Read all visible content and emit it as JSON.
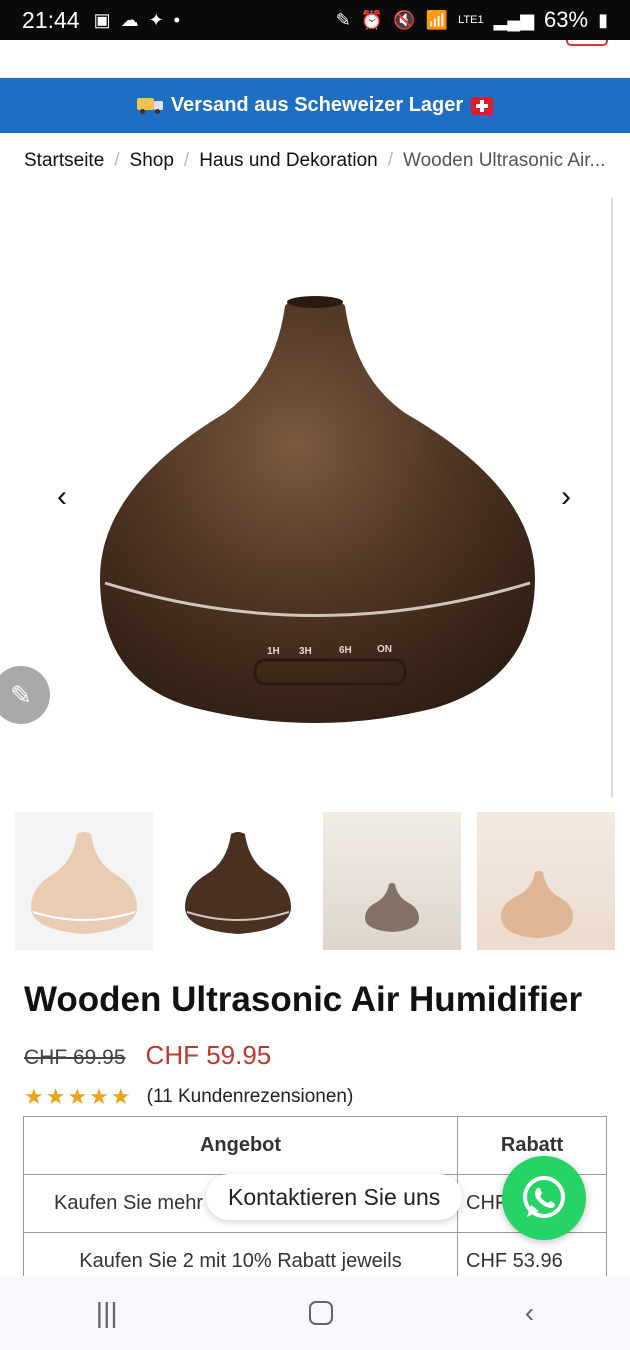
{
  "status_bar": {
    "time": "21:44",
    "battery": "63%",
    "network": "LTE1"
  },
  "banner": {
    "text": "Versand aus Scheweizer Lager"
  },
  "breadcrumb": {
    "items": [
      "Startseite",
      "Shop",
      "Haus und Dekoration",
      "Wooden Ultrasonic Air..."
    ]
  },
  "product_image": {
    "timer_labels": [
      "1H",
      "3H",
      "6H",
      "ON"
    ]
  },
  "product": {
    "title": "Wooden Ultrasonic Air Humidifier",
    "old_price": "CHF 69.95",
    "new_price": "CHF 59.95",
    "rating_stars": 5,
    "reviews": "(11 Kundenrezensionen)"
  },
  "offers_table": {
    "headers": [
      "Angebot",
      "Rabatt"
    ],
    "rows": [
      {
        "offer": "Kaufen Sie mehr",
        "discount": "CHF"
      },
      {
        "offer": "Kaufen Sie 2 mit 10% Rabatt jeweils",
        "discount": "CHF 53.96"
      }
    ]
  },
  "contact": {
    "label": "Kontaktieren Sie uns"
  },
  "colors": {
    "banner_blue": "#1d6fc4",
    "sale_red": "#c0392b",
    "star_gold": "#f0a318",
    "whatsapp_green": "#25d366"
  }
}
